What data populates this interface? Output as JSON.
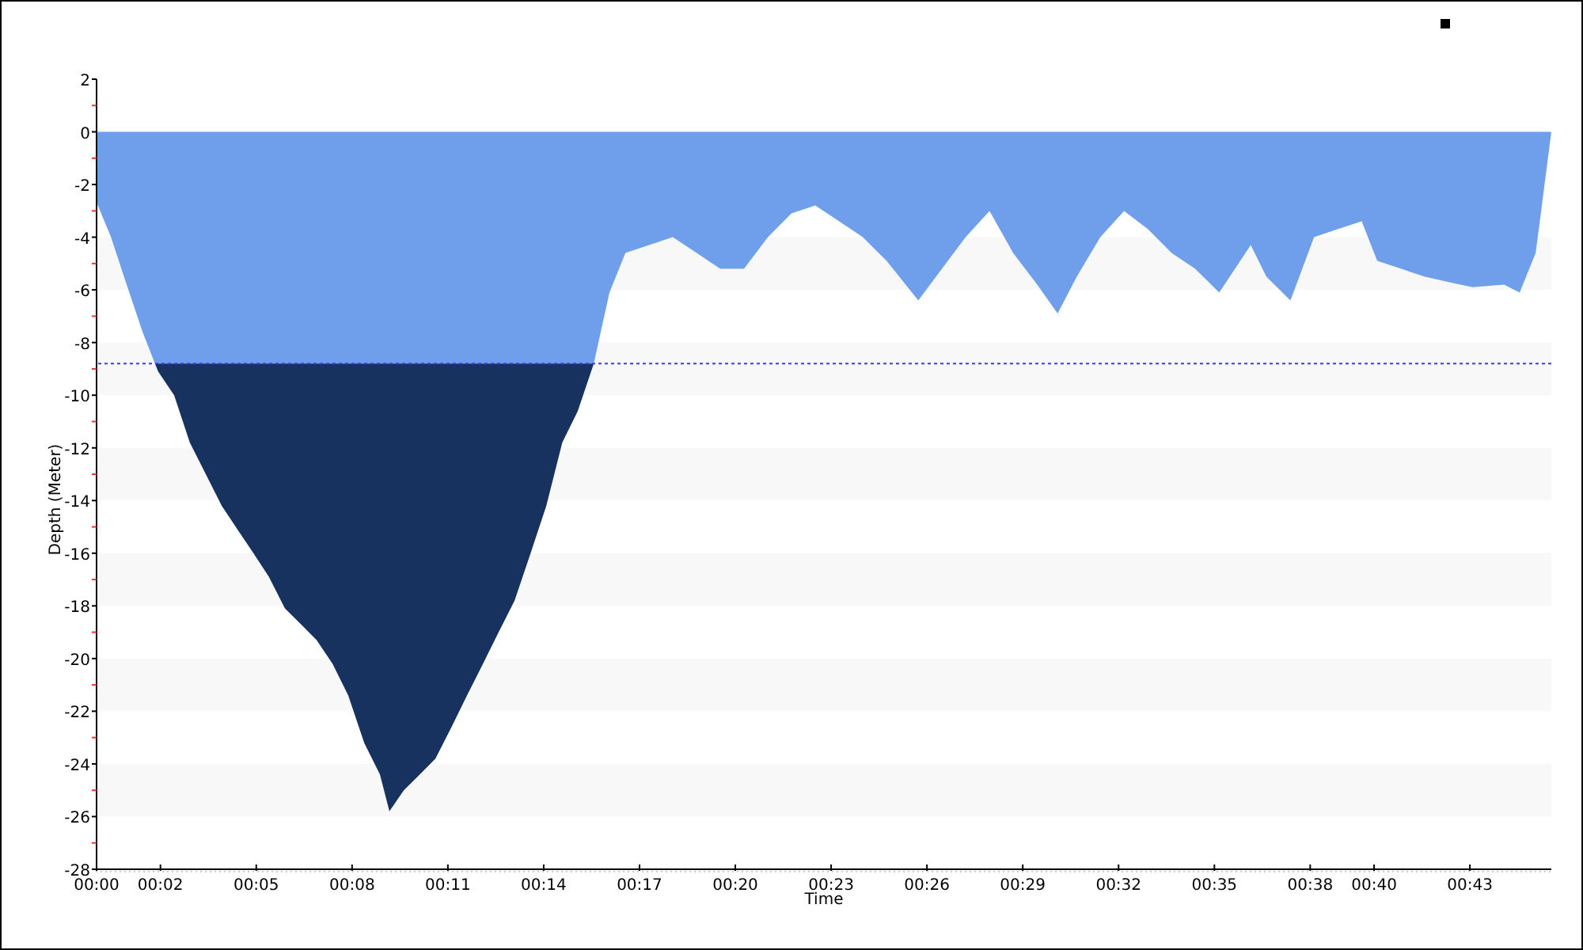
{
  "chart": {
    "chart_data": {
      "type": "area",
      "xlabel": "Time",
      "ylabel": "Depth (Meter)",
      "stacked": true,
      "x": [
        0,
        0.01,
        0.45,
        0.94,
        1.44,
        1.83,
        1.93,
        2.43,
        2.92,
        3.42,
        3.92,
        4.41,
        4.91,
        5.4,
        5.9,
        6.4,
        6.89,
        7.39,
        7.88,
        8.38,
        8.87,
        9.17,
        9.62,
        10.12,
        10.61,
        11.11,
        11.6,
        12.1,
        12.59,
        13.09,
        13.59,
        14.08,
        14.58,
        15.07,
        15.57,
        16.06,
        16.56,
        17.3,
        18.04,
        18.79,
        19.53,
        20.27,
        21.02,
        21.76,
        22.5,
        23.25,
        23.99,
        24.74,
        25.73,
        26.47,
        27.21,
        27.96,
        28.7,
        29.45,
        30.09,
        30.69,
        31.43,
        32.17,
        32.92,
        33.66,
        34.4,
        35.15,
        36.14,
        36.63,
        37.38,
        38.12,
        38.86,
        39.61,
        40.1,
        40.85,
        41.59,
        42.33,
        43.08,
        44.07,
        44.56,
        45.06,
        45.55
      ],
      "series": [
        {
          "color": "#6f9fea",
          "values": [
            0,
            -2.7,
            -4,
            -5.8,
            -7.6,
            -8.8,
            -8.8,
            -8.8,
            -8.8,
            -8.8,
            -8.8,
            -8.8,
            -8.8,
            -8.8,
            -8.8,
            -8.8,
            -8.8,
            -8.8,
            -8.8,
            -8.8,
            -8.8,
            -8.8,
            -8.8,
            -8.8,
            -8.8,
            -8.8,
            -8.8,
            -8.8,
            -8.8,
            -8.8,
            -8.8,
            -8.8,
            -8.8,
            -8.8,
            -8.8,
            -6.1,
            -4.6,
            -4.3,
            -4,
            -4.6,
            -5.2,
            -5.2,
            -4,
            -3.1,
            -2.8,
            -3.4,
            -4,
            -4.9,
            -6.4,
            -5.2,
            -4,
            -3,
            -4.6,
            -5.8,
            -6.9,
            -5.5,
            -4,
            -3,
            -3.7,
            -4.6,
            -5.2,
            -6.1,
            -4.3,
            -5.5,
            -6.4,
            -4,
            -3.7,
            -3.4,
            -4.9,
            -5.2,
            -5.5,
            -5.7,
            -5.9,
            -5.8,
            -6.1,
            -4.6,
            0
          ]
        },
        {
          "color": "#17325e",
          "values": [
            null,
            null,
            null,
            null,
            null,
            0,
            -0.3,
            -1.2,
            -3,
            -4.2,
            -5.4,
            -6.3,
            -7.2,
            -8.1,
            -9.3,
            -9.9,
            -10.5,
            -11.4,
            -12.6,
            -14.4,
            -15.6,
            -17,
            -16.2,
            -15.6,
            -15,
            -13.8,
            -12.6,
            -11.4,
            -10.2,
            -9,
            -7.2,
            -5.4,
            -3,
            -1.8,
            0,
            null,
            null,
            null,
            null,
            null,
            null,
            null,
            null,
            null,
            null,
            null,
            null,
            null,
            null,
            null,
            null,
            null,
            null,
            null,
            null,
            null,
            null,
            null,
            null,
            null,
            null,
            null,
            null,
            null,
            null,
            null,
            null,
            null,
            null,
            null,
            null,
            null,
            null,
            null,
            null,
            null,
            null
          ]
        }
      ],
      "xlim": [
        0,
        45.55
      ],
      "ylim": [
        -28,
        2
      ],
      "xticks": [
        {
          "value": 0,
          "label": "00:00"
        },
        {
          "value": 2,
          "label": "00:02"
        },
        {
          "value": 5,
          "label": "00:05"
        },
        {
          "value": 8,
          "label": "00:08"
        },
        {
          "value": 11,
          "label": "00:11"
        },
        {
          "value": 14,
          "label": "00:14"
        },
        {
          "value": 17,
          "label": "00:17"
        },
        {
          "value": 20,
          "label": "00:20"
        },
        {
          "value": 23,
          "label": "00:23"
        },
        {
          "value": 26,
          "label": "00:26"
        },
        {
          "value": 29,
          "label": "00:29"
        },
        {
          "value": 32,
          "label": "00:32"
        },
        {
          "value": 35,
          "label": "00:35"
        },
        {
          "value": 38,
          "label": "00:38"
        },
        {
          "value": 40,
          "label": "00:40"
        },
        {
          "value": 43,
          "label": "00:43"
        }
      ],
      "yticks": [
        2,
        0,
        -2,
        -4,
        -6,
        -8,
        -10,
        -12,
        -14,
        -16,
        -18,
        -20,
        -22,
        -24,
        -26,
        -28
      ],
      "ref_lines": [
        {
          "axis": "y",
          "value": -8.8,
          "color": "#3a3aff"
        }
      ]
    }
  }
}
